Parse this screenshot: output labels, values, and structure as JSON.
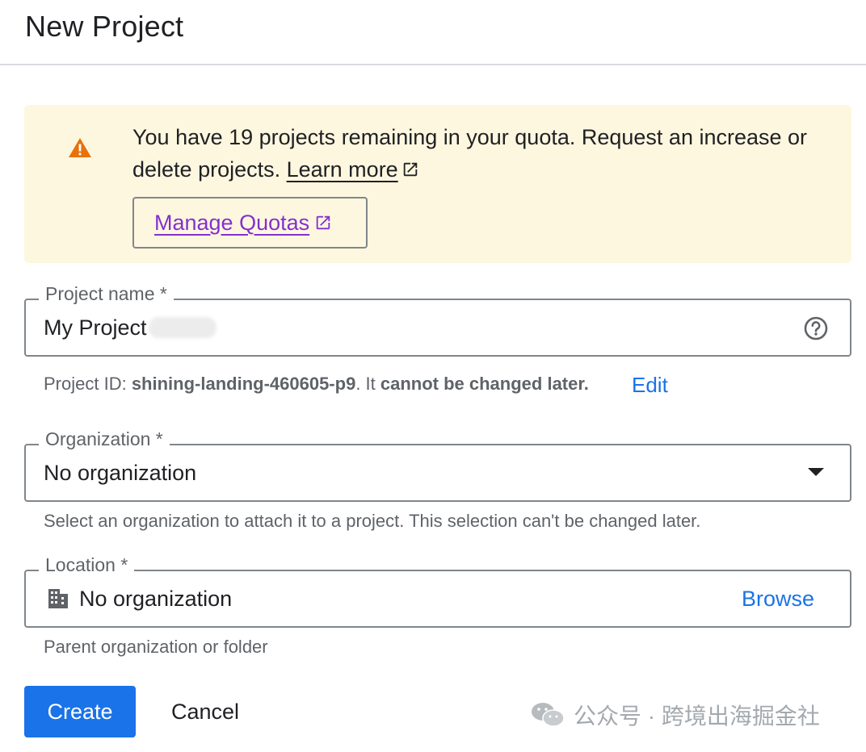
{
  "header": {
    "title": "New Project"
  },
  "quota": {
    "message": "You have 19 projects remaining in your quota. Request an increase or delete projects.",
    "learn_more": "Learn more",
    "manage_button": "Manage Quotas"
  },
  "project_name": {
    "label": "Project name *",
    "value": "My Project"
  },
  "project_id": {
    "prefix": "Project ID: ",
    "id": "shining-landing-460605-p9",
    "middle": ". It ",
    "warning": "cannot be changed later.",
    "edit": "Edit"
  },
  "organization": {
    "label": "Organization *",
    "value": "No organization",
    "helper": "Select an organization to attach it to a project. This selection can't be changed later."
  },
  "location": {
    "label": "Location *",
    "value": "No organization",
    "browse": "Browse",
    "helper": "Parent organization or folder"
  },
  "actions": {
    "create": "Create",
    "cancel": "Cancel"
  },
  "watermark": {
    "text": "公众号 · 跨境出海掘金社"
  },
  "colors": {
    "primary": "#1a73e8",
    "warning": "#e8710a",
    "banner_bg": "#fef7e0",
    "manage_link": "#8430ce"
  }
}
